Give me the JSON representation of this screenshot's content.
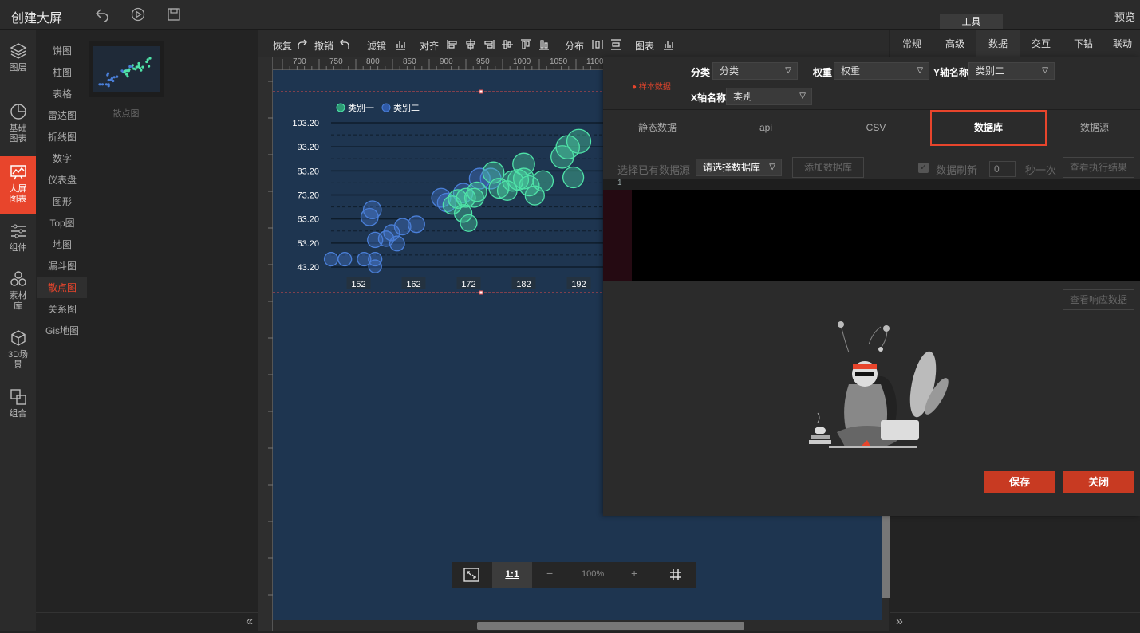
{
  "topbar": {
    "title": "创建大屏",
    "preview": "预览",
    "tools_tab": "工具"
  },
  "leftnav": [
    {
      "label": "图层",
      "icon": "layers-icon"
    },
    {
      "label": "基础图表",
      "icon": "pie-chart-icon"
    },
    {
      "label": "大屏图表",
      "icon": "screen-chart-icon",
      "active": true
    },
    {
      "label": "组件",
      "icon": "sliders-icon"
    },
    {
      "label": "素材库",
      "icon": "material-icon"
    },
    {
      "label": "3D场景",
      "icon": "cube-icon"
    },
    {
      "label": "组合",
      "icon": "group-icon"
    }
  ],
  "categories": [
    "饼图",
    "柱图",
    "表格",
    "雷达图",
    "折线图",
    "数字",
    "仪表盘",
    "图形",
    "Top图",
    "地图",
    "漏斗图",
    "散点图",
    "关系图",
    "Gis地图"
  ],
  "active_category": "散点图",
  "thumbnail_label": "散点图",
  "toolbar": {
    "redo": "恢复",
    "undo": "撤销",
    "filter": "滤镜",
    "align": "对齐",
    "distribute": "分布",
    "chart": "图表"
  },
  "ruler_ticks": [
    "700",
    "750",
    "800",
    "850",
    "900",
    "950",
    "1000",
    "1050",
    "1100"
  ],
  "props_tabs": [
    "常规",
    "高级",
    "数据",
    "交互",
    "下钻",
    "联动"
  ],
  "active_props_tab": "数据",
  "datapanel": {
    "sample_data": "样本数据",
    "category_label": "分类",
    "category_value": "分类",
    "weight_label": "权重",
    "weight_value": "权重",
    "yaxis_label": "Y轴名称",
    "yaxis_value": "类别二",
    "xaxis_label": "X轴名称",
    "xaxis_value": "类别一",
    "source_tabs": [
      "静态数据",
      "api",
      "CSV",
      "数据库",
      "数据源"
    ],
    "active_source": "数据库",
    "choose_source": "选择已有数据源",
    "db_select_placeholder": "请选择数据库",
    "add_db": "添加数据库",
    "refresh": "数据刷新",
    "refresh_value": "0",
    "per_second": "秒一次",
    "view_result": "查看执行结果",
    "line_number": "1",
    "view_response": "查看响应数据",
    "save": "保存",
    "close": "关闭"
  },
  "zoom": {
    "one_to_one": "1:1",
    "minus": "−",
    "percent": "100%",
    "plus": "+"
  },
  "chart_data": {
    "type": "scatter",
    "legend": [
      "类别一",
      "类别二"
    ],
    "legend_placement": "top-left",
    "y_ticks": [
      "103.20",
      "93.20",
      "83.20",
      "73.20",
      "63.20",
      "53.20",
      "43.20"
    ],
    "x_ticks": [
      "152",
      "162",
      "172",
      "182",
      "192"
    ],
    "xlim": [
      147,
      197
    ],
    "ylim": [
      43.2,
      103.2
    ],
    "colors": {
      "类别一": "#4fe3a8",
      "类别二": "#4a7fd8"
    },
    "series": [
      {
        "name": "类别二",
        "points": [
          [
            147,
            46.5
          ],
          [
            149.5,
            46.5
          ],
          [
            153,
            46.5
          ],
          [
            155,
            46.5
          ],
          [
            155,
            43.5
          ],
          [
            154,
            64
          ],
          [
            154.5,
            67
          ],
          [
            155,
            54.5
          ],
          [
            157,
            55
          ],
          [
            158,
            57.5
          ],
          [
            159,
            53
          ],
          [
            160,
            60
          ],
          [
            162.5,
            61
          ],
          [
            167,
            72
          ],
          [
            168,
            70
          ],
          [
            171,
            74
          ],
          [
            174,
            80
          ],
          [
            176,
            80
          ]
        ]
      },
      {
        "name": "类别一",
        "points": [
          [
            169,
            69
          ],
          [
            170,
            71.5
          ],
          [
            171,
            65.5
          ],
          [
            171.5,
            72
          ],
          [
            172,
            61.5
          ],
          [
            173,
            72
          ],
          [
            173.5,
            74.5
          ],
          [
            176.5,
            82.5
          ],
          [
            177.5,
            76
          ],
          [
            179,
            75
          ],
          [
            180,
            79
          ],
          [
            181,
            79.5
          ],
          [
            182,
            86
          ],
          [
            182,
            80
          ],
          [
            183,
            77
          ],
          [
            184,
            73
          ],
          [
            185.5,
            79
          ],
          [
            189,
            89
          ],
          [
            190,
            93
          ],
          [
            191,
            80.5
          ],
          [
            192,
            95.5
          ]
        ]
      }
    ]
  }
}
